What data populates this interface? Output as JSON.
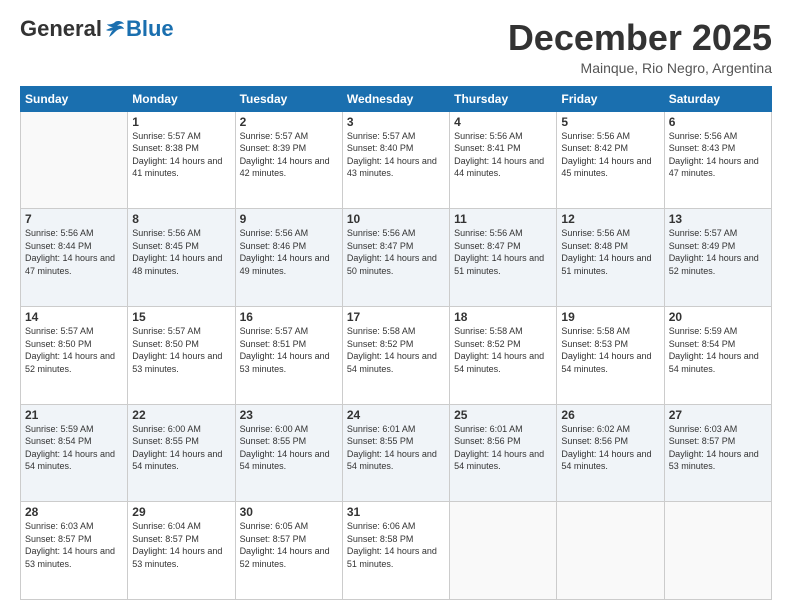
{
  "logo": {
    "general": "General",
    "blue": "Blue"
  },
  "title": "December 2025",
  "location": "Mainque, Rio Negro, Argentina",
  "days_header": [
    "Sunday",
    "Monday",
    "Tuesday",
    "Wednesday",
    "Thursday",
    "Friday",
    "Saturday"
  ],
  "weeks": [
    [
      {
        "day": "",
        "sunrise": "",
        "sunset": "",
        "daylight": ""
      },
      {
        "day": "1",
        "sunrise": "Sunrise: 5:57 AM",
        "sunset": "Sunset: 8:38 PM",
        "daylight": "Daylight: 14 hours and 41 minutes."
      },
      {
        "day": "2",
        "sunrise": "Sunrise: 5:57 AM",
        "sunset": "Sunset: 8:39 PM",
        "daylight": "Daylight: 14 hours and 42 minutes."
      },
      {
        "day": "3",
        "sunrise": "Sunrise: 5:57 AM",
        "sunset": "Sunset: 8:40 PM",
        "daylight": "Daylight: 14 hours and 43 minutes."
      },
      {
        "day": "4",
        "sunrise": "Sunrise: 5:56 AM",
        "sunset": "Sunset: 8:41 PM",
        "daylight": "Daylight: 14 hours and 44 minutes."
      },
      {
        "day": "5",
        "sunrise": "Sunrise: 5:56 AM",
        "sunset": "Sunset: 8:42 PM",
        "daylight": "Daylight: 14 hours and 45 minutes."
      },
      {
        "day": "6",
        "sunrise": "Sunrise: 5:56 AM",
        "sunset": "Sunset: 8:43 PM",
        "daylight": "Daylight: 14 hours and 47 minutes."
      }
    ],
    [
      {
        "day": "7",
        "sunrise": "Sunrise: 5:56 AM",
        "sunset": "Sunset: 8:44 PM",
        "daylight": "Daylight: 14 hours and 47 minutes."
      },
      {
        "day": "8",
        "sunrise": "Sunrise: 5:56 AM",
        "sunset": "Sunset: 8:45 PM",
        "daylight": "Daylight: 14 hours and 48 minutes."
      },
      {
        "day": "9",
        "sunrise": "Sunrise: 5:56 AM",
        "sunset": "Sunset: 8:46 PM",
        "daylight": "Daylight: 14 hours and 49 minutes."
      },
      {
        "day": "10",
        "sunrise": "Sunrise: 5:56 AM",
        "sunset": "Sunset: 8:47 PM",
        "daylight": "Daylight: 14 hours and 50 minutes."
      },
      {
        "day": "11",
        "sunrise": "Sunrise: 5:56 AM",
        "sunset": "Sunset: 8:47 PM",
        "daylight": "Daylight: 14 hours and 51 minutes."
      },
      {
        "day": "12",
        "sunrise": "Sunrise: 5:56 AM",
        "sunset": "Sunset: 8:48 PM",
        "daylight": "Daylight: 14 hours and 51 minutes."
      },
      {
        "day": "13",
        "sunrise": "Sunrise: 5:57 AM",
        "sunset": "Sunset: 8:49 PM",
        "daylight": "Daylight: 14 hours and 52 minutes."
      }
    ],
    [
      {
        "day": "14",
        "sunrise": "Sunrise: 5:57 AM",
        "sunset": "Sunset: 8:50 PM",
        "daylight": "Daylight: 14 hours and 52 minutes."
      },
      {
        "day": "15",
        "sunrise": "Sunrise: 5:57 AM",
        "sunset": "Sunset: 8:50 PM",
        "daylight": "Daylight: 14 hours and 53 minutes."
      },
      {
        "day": "16",
        "sunrise": "Sunrise: 5:57 AM",
        "sunset": "Sunset: 8:51 PM",
        "daylight": "Daylight: 14 hours and 53 minutes."
      },
      {
        "day": "17",
        "sunrise": "Sunrise: 5:58 AM",
        "sunset": "Sunset: 8:52 PM",
        "daylight": "Daylight: 14 hours and 54 minutes."
      },
      {
        "day": "18",
        "sunrise": "Sunrise: 5:58 AM",
        "sunset": "Sunset: 8:52 PM",
        "daylight": "Daylight: 14 hours and 54 minutes."
      },
      {
        "day": "19",
        "sunrise": "Sunrise: 5:58 AM",
        "sunset": "Sunset: 8:53 PM",
        "daylight": "Daylight: 14 hours and 54 minutes."
      },
      {
        "day": "20",
        "sunrise": "Sunrise: 5:59 AM",
        "sunset": "Sunset: 8:54 PM",
        "daylight": "Daylight: 14 hours and 54 minutes."
      }
    ],
    [
      {
        "day": "21",
        "sunrise": "Sunrise: 5:59 AM",
        "sunset": "Sunset: 8:54 PM",
        "daylight": "Daylight: 14 hours and 54 minutes."
      },
      {
        "day": "22",
        "sunrise": "Sunrise: 6:00 AM",
        "sunset": "Sunset: 8:55 PM",
        "daylight": "Daylight: 14 hours and 54 minutes."
      },
      {
        "day": "23",
        "sunrise": "Sunrise: 6:00 AM",
        "sunset": "Sunset: 8:55 PM",
        "daylight": "Daylight: 14 hours and 54 minutes."
      },
      {
        "day": "24",
        "sunrise": "Sunrise: 6:01 AM",
        "sunset": "Sunset: 8:55 PM",
        "daylight": "Daylight: 14 hours and 54 minutes."
      },
      {
        "day": "25",
        "sunrise": "Sunrise: 6:01 AM",
        "sunset": "Sunset: 8:56 PM",
        "daylight": "Daylight: 14 hours and 54 minutes."
      },
      {
        "day": "26",
        "sunrise": "Sunrise: 6:02 AM",
        "sunset": "Sunset: 8:56 PM",
        "daylight": "Daylight: 14 hours and 54 minutes."
      },
      {
        "day": "27",
        "sunrise": "Sunrise: 6:03 AM",
        "sunset": "Sunset: 8:57 PM",
        "daylight": "Daylight: 14 hours and 53 minutes."
      }
    ],
    [
      {
        "day": "28",
        "sunrise": "Sunrise: 6:03 AM",
        "sunset": "Sunset: 8:57 PM",
        "daylight": "Daylight: 14 hours and 53 minutes."
      },
      {
        "day": "29",
        "sunrise": "Sunrise: 6:04 AM",
        "sunset": "Sunset: 8:57 PM",
        "daylight": "Daylight: 14 hours and 53 minutes."
      },
      {
        "day": "30",
        "sunrise": "Sunrise: 6:05 AM",
        "sunset": "Sunset: 8:57 PM",
        "daylight": "Daylight: 14 hours and 52 minutes."
      },
      {
        "day": "31",
        "sunrise": "Sunrise: 6:06 AM",
        "sunset": "Sunset: 8:58 PM",
        "daylight": "Daylight: 14 hours and 51 minutes."
      },
      {
        "day": "",
        "sunrise": "",
        "sunset": "",
        "daylight": ""
      },
      {
        "day": "",
        "sunrise": "",
        "sunset": "",
        "daylight": ""
      },
      {
        "day": "",
        "sunrise": "",
        "sunset": "",
        "daylight": ""
      }
    ]
  ]
}
